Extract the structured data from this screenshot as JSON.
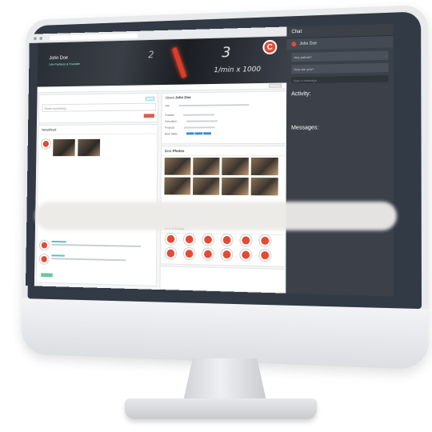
{
  "profile": {
    "name": "John Doe",
    "subtitle": "Life Partners & Founder"
  },
  "cover": {
    "gauge_numbers": [
      "2",
      "3"
    ],
    "rpm_label": "1/min x 1000"
  },
  "status_card": {
    "title": "Share something",
    "placeholder": "Share something"
  },
  "newsfeed": {
    "title": "Newsfeed"
  },
  "about": {
    "title_prefix": "About",
    "name": "John Doe",
    "rows": [
      {
        "label": "Info"
      },
      {
        "label": "Position"
      },
      {
        "label": "Education"
      },
      {
        "label": "Projects"
      },
      {
        "label": "Best Skills"
      }
    ]
  },
  "photos": {
    "title_prefix": "Best",
    "title_emphasis": "Photos"
  },
  "friends": {
    "title_prefix": "New",
    "title_emphasis": "Friends"
  },
  "chat": {
    "title": "Chat",
    "user": "John Doe",
    "messages": [
      "Hey pakcat?",
      "How are you?"
    ],
    "input_placeholder": "Type a message..."
  },
  "activity": {
    "title": "Activity:"
  },
  "messages_section": {
    "title": "Messages:"
  },
  "colors": {
    "accent_red": "#e24b33",
    "teal": "#55c0c2",
    "sidebar": "#3b4049"
  }
}
